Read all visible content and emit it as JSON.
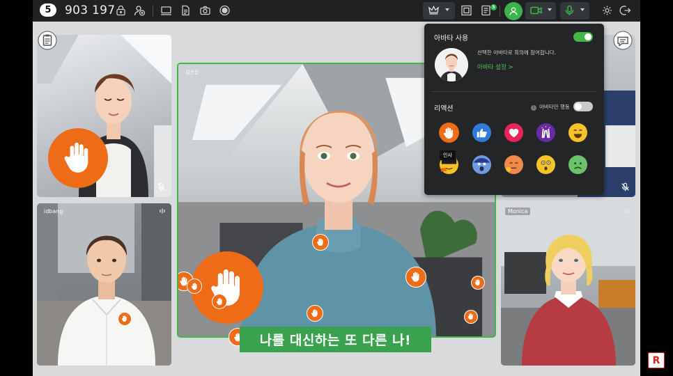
{
  "topbar": {
    "meeting_count": "5",
    "room_id": "903 197",
    "icons": [
      "lock-icon",
      "add-user-icon",
      "screen-share-icon",
      "document-icon",
      "camera-icon",
      "record-icon",
      "crown-icon",
      "layout-icon",
      "chat-list-icon",
      "avatar-icon",
      "video-icon",
      "mic-icon",
      "settings-icon",
      "exit-icon"
    ],
    "chat_badge": "5"
  },
  "tiles": [
    {
      "id": "tile-top-left",
      "name": ""
    },
    {
      "id": "tile-center",
      "name": "김은진"
    },
    {
      "id": "tile-bottom-left",
      "name": "idbang"
    },
    {
      "id": "tile-bottom-right",
      "name": "Monica"
    },
    {
      "id": "tile-top-right",
      "name": ""
    }
  ],
  "caption": "나를 대신하는 또 다른 나!",
  "avatar_panel": {
    "title": "아바타 사용",
    "enabled": true,
    "description": "선택한 아바타로 회의에 참여합니다.",
    "settings_link": "아바타 설정 >",
    "reactions_title": "리액션",
    "avatar_only_label": "아바타만 행동",
    "avatar_only_enabled": false,
    "tooltip": "인사",
    "reactions": [
      "wave",
      "thumbs-up",
      "heart",
      "clap",
      "laugh",
      "greet",
      "surprised",
      "sorry",
      "shocked",
      "sad"
    ]
  },
  "colors": {
    "accent_green": "#3aa24e",
    "reaction_orange": "#ee6b17",
    "topbar_bg": "#1f2123",
    "panel_bg": "#232527"
  }
}
